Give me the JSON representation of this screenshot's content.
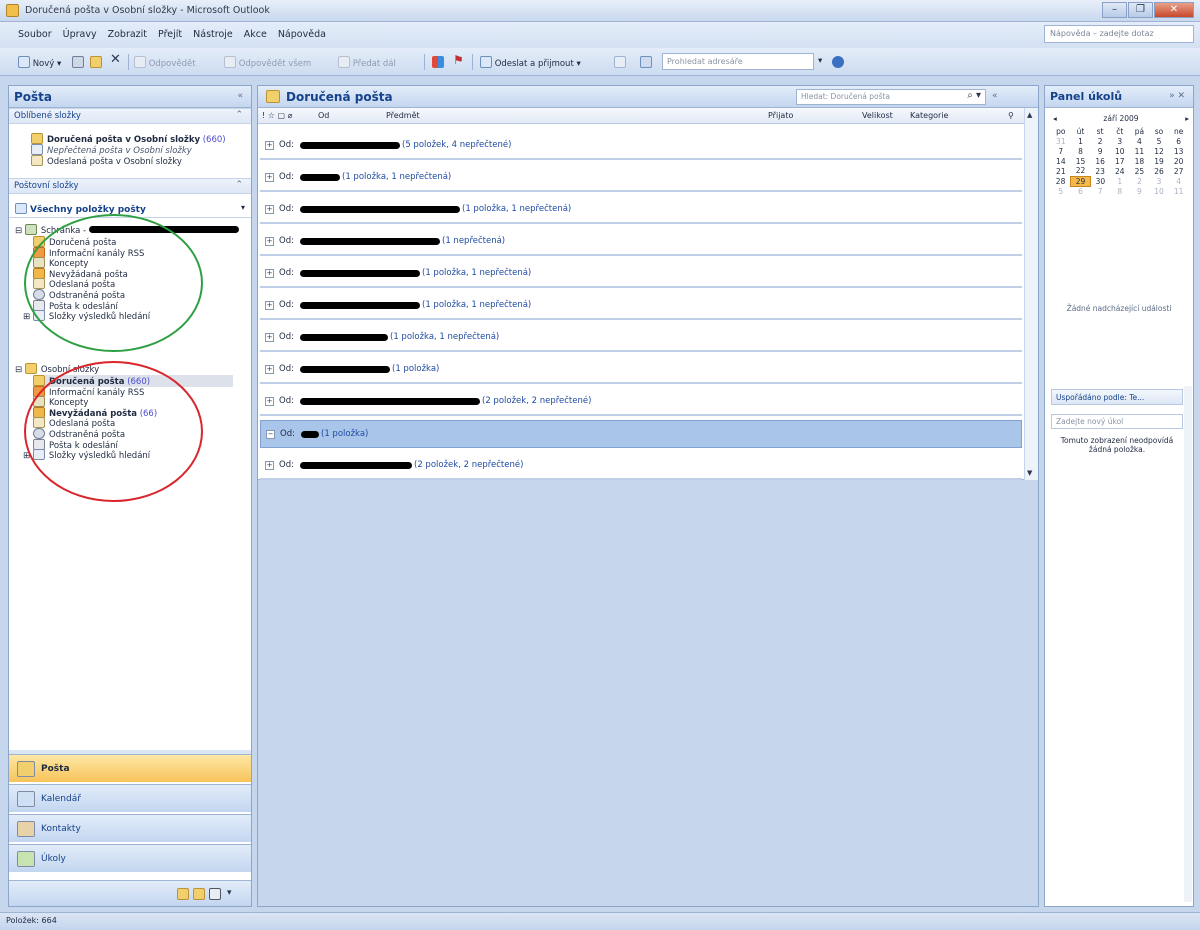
{
  "window": {
    "title": "Doručená pošta v Osobní složky - Microsoft Outlook",
    "help_placeholder": "Nápověda – zadejte dotaz"
  },
  "menu": [
    "Soubor",
    "Úpravy",
    "Zobrazit",
    "Přejít",
    "Nástroje",
    "Akce",
    "Nápověda"
  ],
  "toolbar": {
    "new_label": "Nový",
    "reply_label": "Odpovědět",
    "reply_all_label": "Odpovědět všem",
    "forward_label": "Předat dál",
    "send_receive_label": "Odeslat a přijmout",
    "address_search_placeholder": "Prohledat adresáře"
  },
  "nav": {
    "title": "Pošta",
    "favorites_header": "Oblíbené složky",
    "favorites": [
      {
        "label": "Doručená pošta v Osobní složky",
        "count": "(660)",
        "bold": true
      },
      {
        "label": "Nepřečtená pošta v Osobní složky",
        "count": "",
        "bold": false
      },
      {
        "label": "Odeslaná pošta v Osobní složky",
        "count": "",
        "bold": false
      }
    ],
    "mail_folders_header": "Poštovní složky",
    "all_mail_label": "Všechny položky pošty",
    "account1": {
      "label": "Schránka - ",
      "folders": [
        "Doručená pošta",
        "Informační kanály RSS",
        "Koncepty",
        "Nevyžádaná pošta",
        "Odeslaná pošta",
        "Odstraněná pošta",
        "Pošta k odeslání",
        "Složky výsledků hledání"
      ]
    },
    "account2": {
      "label": "Osobní složky",
      "folders": [
        {
          "label": "Doručená pošta",
          "count": "(660)",
          "bold": true
        },
        {
          "label": "Informační kanály RSS",
          "count": "",
          "bold": false
        },
        {
          "label": "Koncepty",
          "count": "",
          "bold": false
        },
        {
          "label": "Nevyžádaná pošta",
          "count": "(66)",
          "bold": true
        },
        {
          "label": "Odeslaná pošta",
          "count": "",
          "bold": false
        },
        {
          "label": "Odstraněná pošta",
          "count": "",
          "bold": false
        },
        {
          "label": "Pošta k odeslání",
          "count": "",
          "bold": false
        },
        {
          "label": "Složky výsledků hledání",
          "count": "",
          "bold": false
        }
      ]
    },
    "buttons": [
      "Pošta",
      "Kalendář",
      "Kontakty",
      "Úkoly"
    ],
    "selected_button": "Pošta"
  },
  "mail": {
    "title": "Doručená pošta",
    "search_placeholder": "Hledat: Doručená pošta",
    "columns": {
      "from": "Od",
      "subject": "Předmět",
      "received": "Přijato",
      "size": "Velikost",
      "category": "Kategorie"
    },
    "group_prefix": "Od:",
    "groups": [
      {
        "info": "(5 položek, 4 nepřečtené)",
        "selected": false
      },
      {
        "info": "(1 položka, 1 nepřečtená)",
        "selected": false
      },
      {
        "info": "(1 položka, 1 nepřečtená)",
        "selected": false
      },
      {
        "info": "(1 nepřečtená)",
        "selected": false
      },
      {
        "info": "(1 položka, 1 nepřečtená)",
        "selected": false
      },
      {
        "info": "(1 položka, 1 nepřečtená)",
        "selected": false
      },
      {
        "info": "(1 položka, 1 nepřečtená)",
        "selected": false
      },
      {
        "info": "(1 položka)",
        "selected": false
      },
      {
        "info": "(2 položek, 2 nepřečtené)",
        "selected": false
      },
      {
        "info": "(1 položka)",
        "selected": true
      },
      {
        "info": "(2 položek, 2 nepřečtené)",
        "selected": false
      }
    ]
  },
  "tasks": {
    "title": "Panel úkolů",
    "month_label": "září 2009",
    "weekdays": [
      "po",
      "út",
      "st",
      "čt",
      "pá",
      "so",
      "ne"
    ],
    "weeks": [
      [
        [
          "31",
          true
        ],
        [
          "1",
          false
        ],
        [
          "2",
          false
        ],
        [
          "3",
          false
        ],
        [
          "4",
          false
        ],
        [
          "5",
          false
        ],
        [
          "6",
          false
        ]
      ],
      [
        [
          "7",
          false
        ],
        [
          "8",
          false
        ],
        [
          "9",
          false
        ],
        [
          "10",
          false
        ],
        [
          "11",
          false
        ],
        [
          "12",
          false
        ],
        [
          "13",
          false
        ]
      ],
      [
        [
          "14",
          false
        ],
        [
          "15",
          false
        ],
        [
          "16",
          false
        ],
        [
          "17",
          false
        ],
        [
          "18",
          false
        ],
        [
          "19",
          false
        ],
        [
          "20",
          false
        ]
      ],
      [
        [
          "21",
          false
        ],
        [
          "22",
          false
        ],
        [
          "23",
          false
        ],
        [
          "24",
          false
        ],
        [
          "25",
          false
        ],
        [
          "26",
          false
        ],
        [
          "27",
          false
        ]
      ],
      [
        [
          "28",
          false
        ],
        [
          "29",
          false
        ],
        [
          "30",
          false
        ],
        [
          "1",
          true
        ],
        [
          "2",
          true
        ],
        [
          "3",
          true
        ],
        [
          "4",
          true
        ]
      ],
      [
        [
          "5",
          true
        ],
        [
          "6",
          true
        ],
        [
          "7",
          true
        ],
        [
          "8",
          true
        ],
        [
          "9",
          true
        ],
        [
          "10",
          true
        ],
        [
          "11",
          true
        ]
      ]
    ],
    "today": "29",
    "no_events": "Žádné nadcházející události",
    "arranged_by": "Uspořádáno podle: Te...",
    "new_task_placeholder": "Zadejte nový úkol",
    "empty_text": "Tomuto zobrazení neodpovídá žádná položka."
  },
  "status": {
    "items_label": "Položek: 664"
  },
  "colors": {
    "annotation_green": "#2ea043",
    "annotation_red": "#d9262c",
    "accent": "#15428b"
  }
}
